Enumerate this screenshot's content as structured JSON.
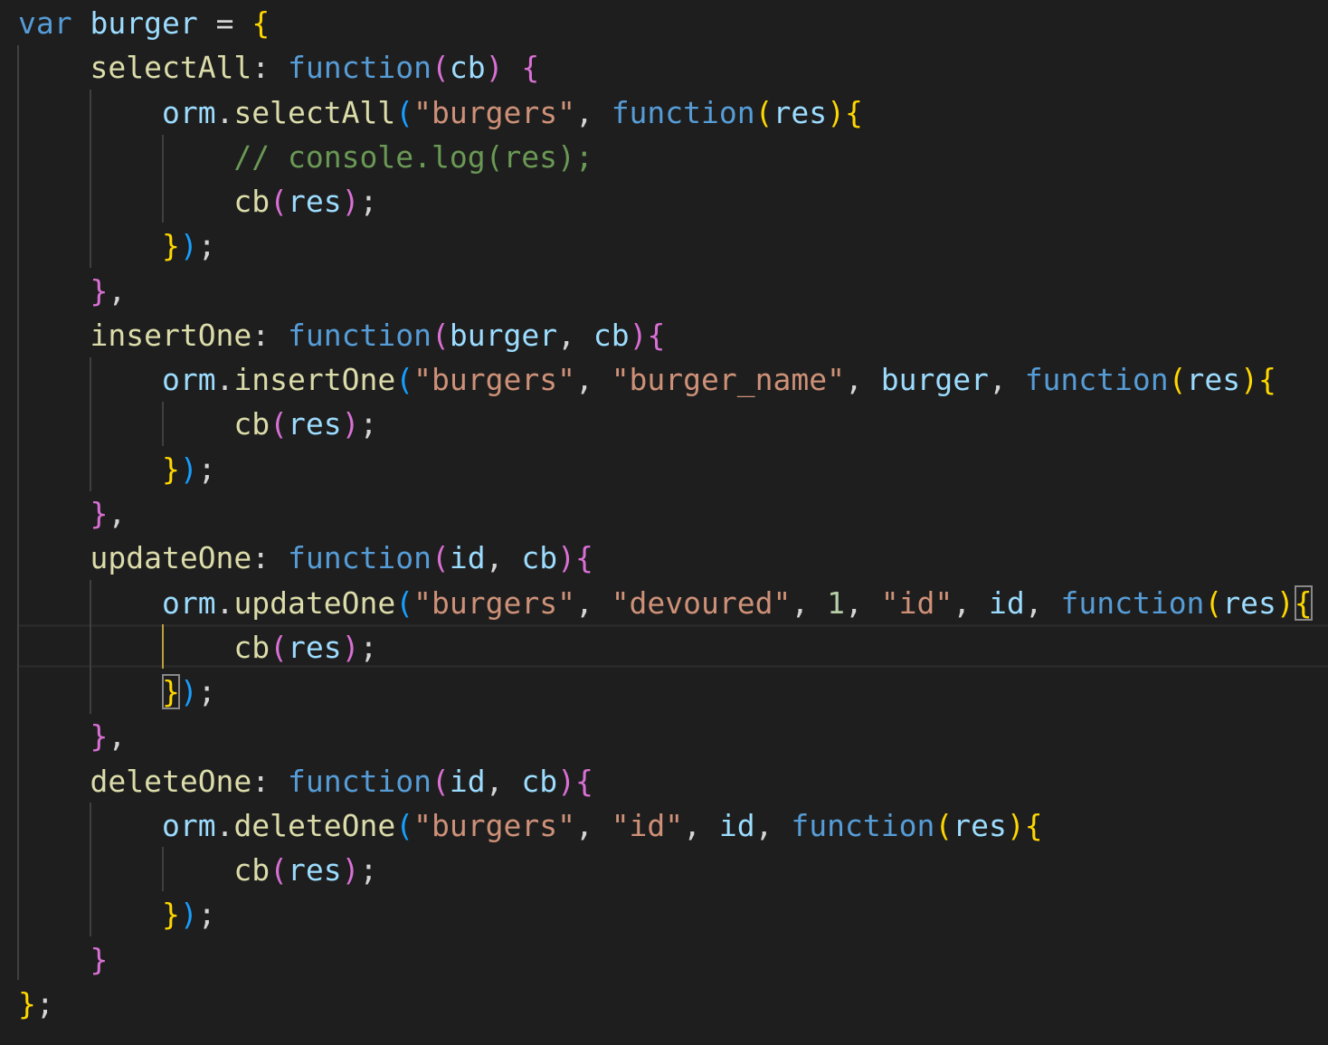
{
  "editor": {
    "language": "javascript",
    "theme_colors": {
      "background": "#1e1e1e",
      "keyword": "#569cd6",
      "variable": "#9cdcfe",
      "function": "#dcdcaa",
      "string": "#ce9178",
      "number": "#b5cea8",
      "comment": "#6a9955",
      "bracket_level1": "#ffd700",
      "bracket_level2": "#da70d6",
      "bracket_level3": "#179fff"
    },
    "lines": [
      [
        [
          "kw",
          "var"
        ],
        [
          "p",
          " "
        ],
        [
          "var",
          "burger"
        ],
        [
          "p",
          " = "
        ],
        [
          "b1",
          "{"
        ]
      ],
      [
        [
          "p",
          "    "
        ],
        [
          "fn",
          "selectAll"
        ],
        [
          "p",
          ": "
        ],
        [
          "kw",
          "function"
        ],
        [
          "b2",
          "("
        ],
        [
          "var",
          "cb"
        ],
        [
          "b2",
          ")"
        ],
        [
          "p",
          " "
        ],
        [
          "b2",
          "{"
        ]
      ],
      [
        [
          "p",
          "        "
        ],
        [
          "var",
          "orm"
        ],
        [
          "p",
          "."
        ],
        [
          "fn",
          "selectAll"
        ],
        [
          "b3",
          "("
        ],
        [
          "str",
          "\"burgers\""
        ],
        [
          "p",
          ", "
        ],
        [
          "kw",
          "function"
        ],
        [
          "b1",
          "("
        ],
        [
          "var",
          "res"
        ],
        [
          "b1",
          ")"
        ],
        [
          "b1",
          "{"
        ]
      ],
      [
        [
          "p",
          "            "
        ],
        [
          "cm",
          "// console.log(res);"
        ]
      ],
      [
        [
          "p",
          "            "
        ],
        [
          "fn",
          "cb"
        ],
        [
          "b2",
          "("
        ],
        [
          "var",
          "res"
        ],
        [
          "b2",
          ")"
        ],
        [
          "p",
          ";"
        ]
      ],
      [
        [
          "p",
          "        "
        ],
        [
          "b1",
          "}"
        ],
        [
          "b3",
          ")"
        ],
        [
          "p",
          ";"
        ]
      ],
      [
        [
          "p",
          "    "
        ],
        [
          "b2",
          "}"
        ],
        [
          "p",
          ","
        ]
      ],
      [
        [
          "p",
          "    "
        ],
        [
          "fn",
          "insertOne"
        ],
        [
          "p",
          ": "
        ],
        [
          "kw",
          "function"
        ],
        [
          "b2",
          "("
        ],
        [
          "var",
          "burger"
        ],
        [
          "p",
          ", "
        ],
        [
          "var",
          "cb"
        ],
        [
          "b2",
          ")"
        ],
        [
          "b2",
          "{"
        ]
      ],
      [
        [
          "p",
          "        "
        ],
        [
          "var",
          "orm"
        ],
        [
          "p",
          "."
        ],
        [
          "fn",
          "insertOne"
        ],
        [
          "b3",
          "("
        ],
        [
          "str",
          "\"burgers\""
        ],
        [
          "p",
          ", "
        ],
        [
          "str",
          "\"burger_name\""
        ],
        [
          "p",
          ", "
        ],
        [
          "var",
          "burger"
        ],
        [
          "p",
          ", "
        ],
        [
          "kw",
          "function"
        ],
        [
          "b1",
          "("
        ],
        [
          "var",
          "res"
        ],
        [
          "b1",
          ")"
        ],
        [
          "b1",
          "{"
        ]
      ],
      [
        [
          "p",
          "            "
        ],
        [
          "fn",
          "cb"
        ],
        [
          "b2",
          "("
        ],
        [
          "var",
          "res"
        ],
        [
          "b2",
          ")"
        ],
        [
          "p",
          ";"
        ]
      ],
      [
        [
          "p",
          "        "
        ],
        [
          "b1",
          "}"
        ],
        [
          "b3",
          ")"
        ],
        [
          "p",
          ";"
        ]
      ],
      [
        [
          "p",
          "    "
        ],
        [
          "b2",
          "}"
        ],
        [
          "p",
          ","
        ]
      ],
      [
        [
          "p",
          "    "
        ],
        [
          "fn",
          "updateOne"
        ],
        [
          "p",
          ": "
        ],
        [
          "kw",
          "function"
        ],
        [
          "b2",
          "("
        ],
        [
          "var",
          "id"
        ],
        [
          "p",
          ", "
        ],
        [
          "var",
          "cb"
        ],
        [
          "b2",
          ")"
        ],
        [
          "b2",
          "{"
        ]
      ],
      [
        [
          "p",
          "        "
        ],
        [
          "var",
          "orm"
        ],
        [
          "p",
          "."
        ],
        [
          "fn",
          "updateOne"
        ],
        [
          "b3",
          "("
        ],
        [
          "str",
          "\"burgers\""
        ],
        [
          "p",
          ", "
        ],
        [
          "str",
          "\"devoured\""
        ],
        [
          "p",
          ", "
        ],
        [
          "num",
          "1"
        ],
        [
          "p",
          ", "
        ],
        [
          "str",
          "\"id\""
        ],
        [
          "p",
          ", "
        ],
        [
          "var",
          "id"
        ],
        [
          "p",
          ", "
        ],
        [
          "kw",
          "function"
        ],
        [
          "b1",
          "("
        ],
        [
          "var",
          "res"
        ],
        [
          "b1",
          ")"
        ],
        [
          "b1",
          "{",
          "box"
        ]
      ],
      [
        [
          "p",
          "            "
        ],
        [
          "fn",
          "cb"
        ],
        [
          "b2",
          "("
        ],
        [
          "var",
          "res"
        ],
        [
          "b2",
          ")"
        ],
        [
          "p",
          ";"
        ]
      ],
      [
        [
          "p",
          "        "
        ],
        [
          "b1",
          "}",
          "box"
        ],
        [
          "b3",
          ")"
        ],
        [
          "p",
          ";"
        ]
      ],
      [
        [
          "p",
          "    "
        ],
        [
          "b2",
          "}"
        ],
        [
          "p",
          ","
        ]
      ],
      [
        [
          "p",
          "    "
        ],
        [
          "fn",
          "deleteOne"
        ],
        [
          "p",
          ": "
        ],
        [
          "kw",
          "function"
        ],
        [
          "b2",
          "("
        ],
        [
          "var",
          "id"
        ],
        [
          "p",
          ", "
        ],
        [
          "var",
          "cb"
        ],
        [
          "b2",
          ")"
        ],
        [
          "b2",
          "{"
        ]
      ],
      [
        [
          "p",
          "        "
        ],
        [
          "var",
          "orm"
        ],
        [
          "p",
          "."
        ],
        [
          "fn",
          "deleteOne"
        ],
        [
          "b3",
          "("
        ],
        [
          "str",
          "\"burgers\""
        ],
        [
          "p",
          ", "
        ],
        [
          "str",
          "\"id\""
        ],
        [
          "p",
          ", "
        ],
        [
          "var",
          "id"
        ],
        [
          "p",
          ", "
        ],
        [
          "kw",
          "function"
        ],
        [
          "b1",
          "("
        ],
        [
          "var",
          "res"
        ],
        [
          "b1",
          ")"
        ],
        [
          "b1",
          "{"
        ]
      ],
      [
        [
          "p",
          "            "
        ],
        [
          "fn",
          "cb"
        ],
        [
          "b2",
          "("
        ],
        [
          "var",
          "res"
        ],
        [
          "b2",
          ")"
        ],
        [
          "p",
          ";"
        ]
      ],
      [
        [
          "p",
          "        "
        ],
        [
          "b1",
          "}"
        ],
        [
          "b3",
          ")"
        ],
        [
          "p",
          ";"
        ]
      ],
      [
        [
          "p",
          "    "
        ],
        [
          "b2",
          "}"
        ]
      ],
      [
        [
          "b1",
          "}"
        ],
        [
          "p",
          ";"
        ]
      ]
    ]
  }
}
